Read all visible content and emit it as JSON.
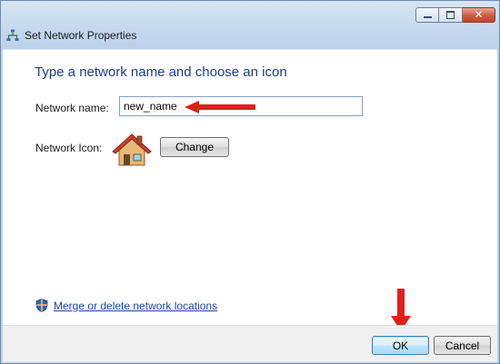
{
  "window": {
    "title": "Set Network Properties",
    "controls": {
      "minimize": "minimize",
      "maximize": "maximize",
      "close": "✕"
    }
  },
  "main": {
    "heading": "Type a network name and choose an icon",
    "network_name_label": "Network name:",
    "network_name_value": "new_name",
    "network_icon_label": "Network Icon:",
    "change_button": "Change",
    "merge_link": "Merge or delete network locations"
  },
  "footer": {
    "ok_button": "OK",
    "cancel_button": "Cancel"
  },
  "icons": [
    "network-icon",
    "house-icon",
    "shield-icon",
    "red-arrow-left-icon",
    "red-arrow-down-icon"
  ],
  "colors": {
    "heading": "#1e3d8f",
    "link": "#1e44a8",
    "annotation_arrow": "#e0201b"
  }
}
